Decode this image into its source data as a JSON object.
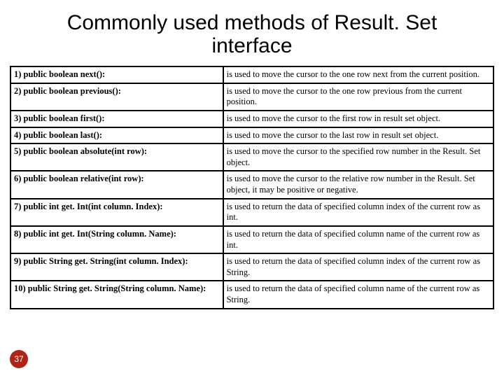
{
  "title": "Commonly used methods of Result. Set interface",
  "page_number": "37",
  "rows": [
    {
      "method": "1) public boolean next():",
      "desc": "is used to move the cursor to the one row next from the current position."
    },
    {
      "method": "2) public boolean previous():",
      "desc": "is used to move the cursor to the one row previous from the current position."
    },
    {
      "method": "3) public boolean first():",
      "desc": "is used to move the cursor to the first row in result set object."
    },
    {
      "method": "4) public boolean last():",
      "desc": "is used to move the cursor to the last row in result set object."
    },
    {
      "method": "5) public boolean absolute(int row):",
      "desc": "is used to move the cursor to the specified row number in the Result. Set object."
    },
    {
      "method": "6) public boolean relative(int row):",
      "desc": "is used to move the cursor to the relative row number in the Result. Set object, it may be positive or negative."
    },
    {
      "method": "7) public int get. Int(int column. Index):",
      "desc": "is used to return the data of specified column index of the current row as int."
    },
    {
      "method": "8) public int get. Int(String column. Name):",
      "desc": "is used to return the data of specified column name of the current row as int."
    },
    {
      "method": "9) public String get. String(int column. Index):",
      "desc": "is used to return the data of specified column index of the current row as String."
    },
    {
      "method": "10) public String get. String(String column. Name):",
      "desc": "is used to return the data of specified column name of the current row as String."
    }
  ]
}
